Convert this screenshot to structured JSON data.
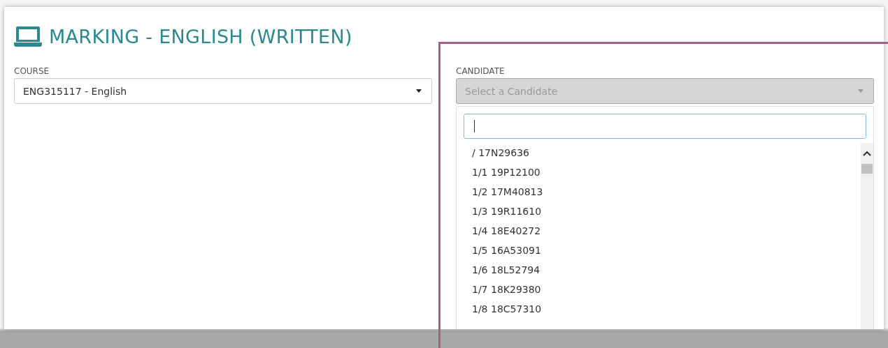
{
  "title": "MARKING - ENGLISH (WRITTEN)",
  "course": {
    "label": "COURSE",
    "value": "ENG315117 - English"
  },
  "candidate": {
    "label": "CANDIDATE",
    "placeholder": "Select a Candidate",
    "disabled": true,
    "expanded": true
  },
  "options": [
    {
      "label": "/ 17N29636"
    },
    {
      "label": "1/1 19P12100"
    },
    {
      "label": "1/2 17M40813"
    },
    {
      "label": "1/3 19R11610"
    },
    {
      "label": "1/4 18E40272"
    },
    {
      "label": "1/5 16A53091"
    },
    {
      "label": "1/6 18L52794"
    },
    {
      "label": "1/7 18K29380"
    },
    {
      "label": "1/8 18C57310"
    }
  ]
}
